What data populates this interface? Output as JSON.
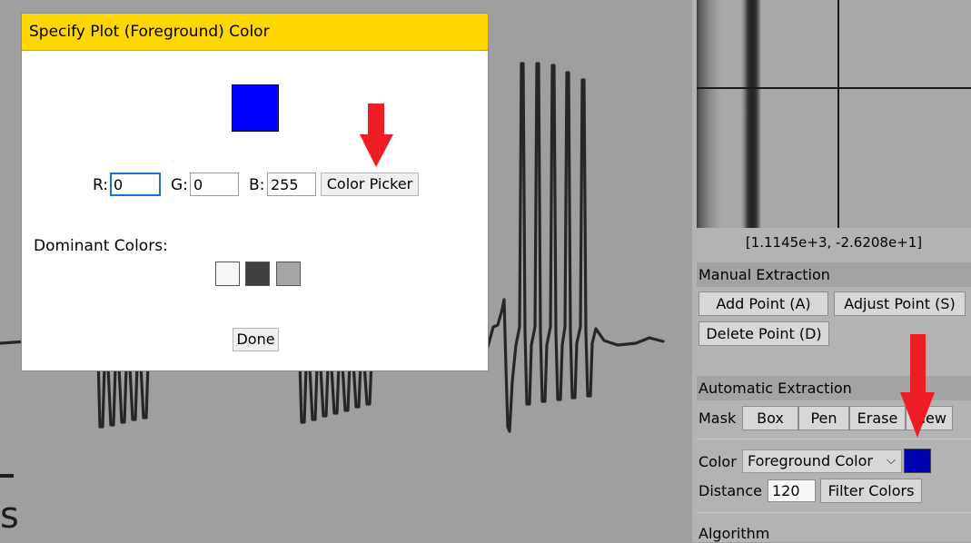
{
  "dialog": {
    "title": "Specify Plot (Foreground) Color",
    "preview_color": "#0000ff",
    "r_label": "R:",
    "g_label": "G:",
    "b_label": "B:",
    "r_value": "0",
    "g_value": "0",
    "b_value": "255",
    "color_picker_label": "Color Picker",
    "dominant_colors_label": "Dominant Colors:",
    "dominant_colors": [
      "#f8f8f8",
      "#404040",
      "#a6a6a6"
    ],
    "done_label": "Done"
  },
  "sidebar": {
    "cursor_readout": "[1.1145e+3, -2.6208e+1]",
    "manual_extraction": {
      "title": "Manual Extraction",
      "add_point_label": "Add Point (A)",
      "adjust_point_label": "Adjust Point (S)",
      "delete_point_label": "Delete Point (D)"
    },
    "automatic_extraction": {
      "title": "Automatic Extraction",
      "mask_label": "Mask",
      "mask_buttons": [
        "Box",
        "Pen",
        "Erase",
        "View"
      ],
      "color_label": "Color",
      "color_mode_value": "Foreground Color",
      "color_swatch": "#0000b4",
      "distance_label": "Distance",
      "distance_value": "120",
      "filter_colors_label": "Filter Colors",
      "algorithm_label": "Algorithm"
    }
  },
  "plot": {
    "axis_letter": "s"
  },
  "colors": {
    "dialog_title_bar": "#ffd700",
    "arrow": "#ee1c25"
  }
}
